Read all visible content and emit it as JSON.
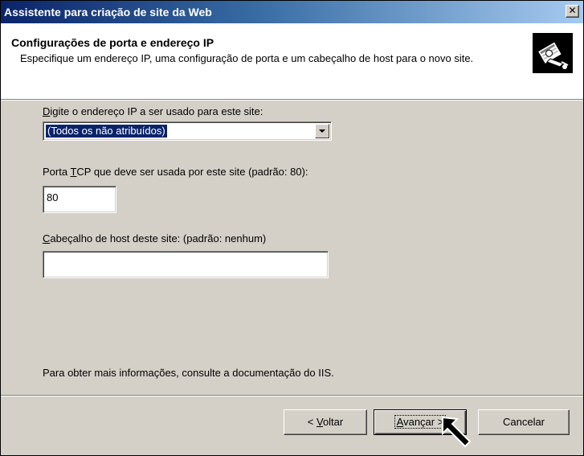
{
  "window": {
    "title": "Assistente para criação de site da Web",
    "close_glyph": "✕"
  },
  "header": {
    "title": "Configurações de porta e endereço IP",
    "subtitle": "Especifique um endereço IP, uma configuração de porta e um cabeçalho de host para o novo site.",
    "icon": "wizard-book-icon"
  },
  "form": {
    "ip_label_mnemonic": "D",
    "ip_label_rest": "igite o endereço IP a ser usado para este site:",
    "ip_value": "(Todos os não atribuídos)",
    "tcp_label_pre": "Porta ",
    "tcp_label_mnemonic": "T",
    "tcp_label_post": "CP que deve ser usada por este site (padrão: 80):",
    "tcp_value": "80",
    "host_label_mnemonic": "C",
    "host_label_rest": "abeçalho de host deste site: (padrão: nenhum)",
    "host_value": "",
    "info_text": "Para obter mais informações, consulte a documentação do IIS."
  },
  "buttons": {
    "back_pre": "< ",
    "back_mnemonic": "V",
    "back_rest": "oltar",
    "next_mnemonic": "A",
    "next_rest": "vançar >",
    "cancel": "Cancelar"
  },
  "colors": {
    "title_gradient_start": "#0a246a",
    "title_gradient_end": "#a6caf0",
    "dialog_face": "#d4d0c8",
    "selection": "#0a246a"
  }
}
